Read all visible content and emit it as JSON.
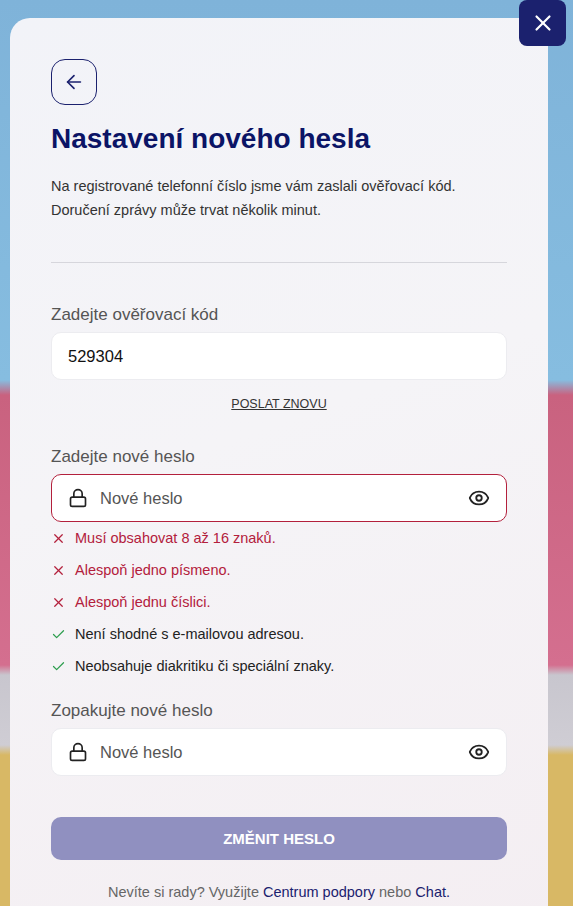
{
  "title": "Nastavení nového hesla",
  "description": "Na registrované telefonní číslo jsme vám zaslali ověřovací kód. Doručení zprávy může trvat několik minut.",
  "code_field": {
    "label": "Zadejte ověřovací kód",
    "value": "529304"
  },
  "resend": "POSLAT ZNOVU",
  "new_password": {
    "label": "Zadejte nové heslo",
    "placeholder": "Nové heslo",
    "invalid": true
  },
  "rules": [
    {
      "text": "Musí obsahovat 8 až 16 znaků.",
      "met": false
    },
    {
      "text": "Alespoň jedno písmeno.",
      "met": false
    },
    {
      "text": "Alespoň jednu číslici.",
      "met": false
    },
    {
      "text": "Není shodné s e-mailovou adresou.",
      "met": true
    },
    {
      "text": "Neobsahuje diakritiku či speciální znaky.",
      "met": true
    }
  ],
  "repeat_password": {
    "label": "Zopakujte nové heslo",
    "placeholder": "Nové heslo",
    "invalid": false
  },
  "submit": {
    "label": "ZMĚNIT HESLO",
    "disabled": true
  },
  "footer": [
    {
      "text": "Nevíte si rady? Využijte",
      "link": false
    },
    {
      "text": "Centrum podpory",
      "link": true
    },
    {
      "text": "nebo",
      "link": false
    },
    {
      "text": "Chat.",
      "link": true
    }
  ]
}
